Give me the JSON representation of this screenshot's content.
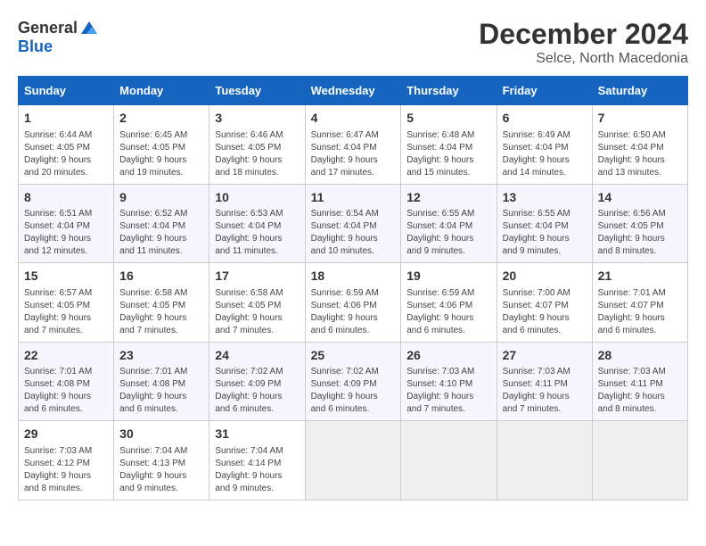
{
  "header": {
    "logo_general": "General",
    "logo_blue": "Blue",
    "month_title": "December 2024",
    "location": "Selce, North Macedonia"
  },
  "weekdays": [
    "Sunday",
    "Monday",
    "Tuesday",
    "Wednesday",
    "Thursday",
    "Friday",
    "Saturday"
  ],
  "weeks": [
    [
      {
        "day": "1",
        "info": "Sunrise: 6:44 AM\nSunset: 4:05 PM\nDaylight: 9 hours\nand 20 minutes."
      },
      {
        "day": "2",
        "info": "Sunrise: 6:45 AM\nSunset: 4:05 PM\nDaylight: 9 hours\nand 19 minutes."
      },
      {
        "day": "3",
        "info": "Sunrise: 6:46 AM\nSunset: 4:05 PM\nDaylight: 9 hours\nand 18 minutes."
      },
      {
        "day": "4",
        "info": "Sunrise: 6:47 AM\nSunset: 4:04 PM\nDaylight: 9 hours\nand 17 minutes."
      },
      {
        "day": "5",
        "info": "Sunrise: 6:48 AM\nSunset: 4:04 PM\nDaylight: 9 hours\nand 15 minutes."
      },
      {
        "day": "6",
        "info": "Sunrise: 6:49 AM\nSunset: 4:04 PM\nDaylight: 9 hours\nand 14 minutes."
      },
      {
        "day": "7",
        "info": "Sunrise: 6:50 AM\nSunset: 4:04 PM\nDaylight: 9 hours\nand 13 minutes."
      }
    ],
    [
      {
        "day": "8",
        "info": "Sunrise: 6:51 AM\nSunset: 4:04 PM\nDaylight: 9 hours\nand 12 minutes."
      },
      {
        "day": "9",
        "info": "Sunrise: 6:52 AM\nSunset: 4:04 PM\nDaylight: 9 hours\nand 11 minutes."
      },
      {
        "day": "10",
        "info": "Sunrise: 6:53 AM\nSunset: 4:04 PM\nDaylight: 9 hours\nand 11 minutes."
      },
      {
        "day": "11",
        "info": "Sunrise: 6:54 AM\nSunset: 4:04 PM\nDaylight: 9 hours\nand 10 minutes."
      },
      {
        "day": "12",
        "info": "Sunrise: 6:55 AM\nSunset: 4:04 PM\nDaylight: 9 hours\nand 9 minutes."
      },
      {
        "day": "13",
        "info": "Sunrise: 6:55 AM\nSunset: 4:04 PM\nDaylight: 9 hours\nand 9 minutes."
      },
      {
        "day": "14",
        "info": "Sunrise: 6:56 AM\nSunset: 4:05 PM\nDaylight: 9 hours\nand 8 minutes."
      }
    ],
    [
      {
        "day": "15",
        "info": "Sunrise: 6:57 AM\nSunset: 4:05 PM\nDaylight: 9 hours\nand 7 minutes."
      },
      {
        "day": "16",
        "info": "Sunrise: 6:58 AM\nSunset: 4:05 PM\nDaylight: 9 hours\nand 7 minutes."
      },
      {
        "day": "17",
        "info": "Sunrise: 6:58 AM\nSunset: 4:05 PM\nDaylight: 9 hours\nand 7 minutes."
      },
      {
        "day": "18",
        "info": "Sunrise: 6:59 AM\nSunset: 4:06 PM\nDaylight: 9 hours\nand 6 minutes."
      },
      {
        "day": "19",
        "info": "Sunrise: 6:59 AM\nSunset: 4:06 PM\nDaylight: 9 hours\nand 6 minutes."
      },
      {
        "day": "20",
        "info": "Sunrise: 7:00 AM\nSunset: 4:07 PM\nDaylight: 9 hours\nand 6 minutes."
      },
      {
        "day": "21",
        "info": "Sunrise: 7:01 AM\nSunset: 4:07 PM\nDaylight: 9 hours\nand 6 minutes."
      }
    ],
    [
      {
        "day": "22",
        "info": "Sunrise: 7:01 AM\nSunset: 4:08 PM\nDaylight: 9 hours\nand 6 minutes."
      },
      {
        "day": "23",
        "info": "Sunrise: 7:01 AM\nSunset: 4:08 PM\nDaylight: 9 hours\nand 6 minutes."
      },
      {
        "day": "24",
        "info": "Sunrise: 7:02 AM\nSunset: 4:09 PM\nDaylight: 9 hours\nand 6 minutes."
      },
      {
        "day": "25",
        "info": "Sunrise: 7:02 AM\nSunset: 4:09 PM\nDaylight: 9 hours\nand 6 minutes."
      },
      {
        "day": "26",
        "info": "Sunrise: 7:03 AM\nSunset: 4:10 PM\nDaylight: 9 hours\nand 7 minutes."
      },
      {
        "day": "27",
        "info": "Sunrise: 7:03 AM\nSunset: 4:11 PM\nDaylight: 9 hours\nand 7 minutes."
      },
      {
        "day": "28",
        "info": "Sunrise: 7:03 AM\nSunset: 4:11 PM\nDaylight: 9 hours\nand 8 minutes."
      }
    ],
    [
      {
        "day": "29",
        "info": "Sunrise: 7:03 AM\nSunset: 4:12 PM\nDaylight: 9 hours\nand 8 minutes."
      },
      {
        "day": "30",
        "info": "Sunrise: 7:04 AM\nSunset: 4:13 PM\nDaylight: 9 hours\nand 9 minutes."
      },
      {
        "day": "31",
        "info": "Sunrise: 7:04 AM\nSunset: 4:14 PM\nDaylight: 9 hours\nand 9 minutes."
      },
      null,
      null,
      null,
      null
    ]
  ]
}
